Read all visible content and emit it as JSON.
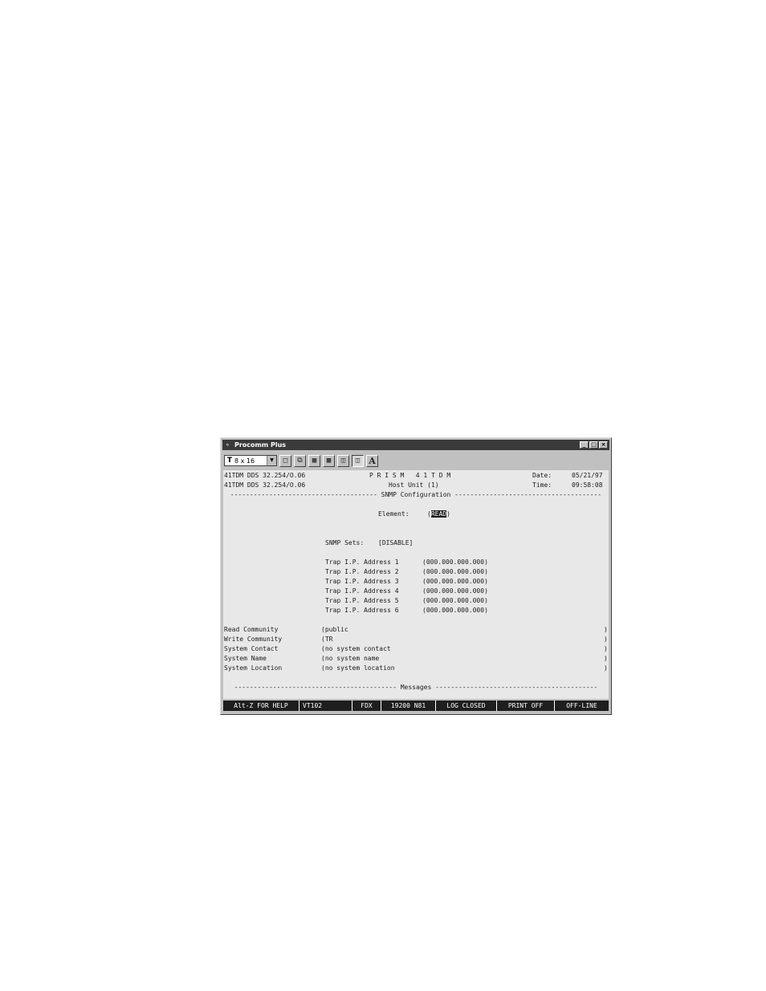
{
  "window": {
    "title": "Procomm Plus"
  },
  "toolbar": {
    "font_size_value": "8 x 16"
  },
  "terminal": {
    "header": {
      "line1_left": "41TDM DDS 32.254/O.06",
      "line1_center": "P R I S M   4 1 T D M",
      "line1_date_label": "Date:",
      "line1_date_value": "05/21/97",
      "line2_left": "41TDM DDS 32.254/O.06",
      "line2_center": "Host Unit (1)",
      "line2_time_label": "Time:",
      "line2_time_value": "09:58:08",
      "section_title": "SNMP Configuration"
    },
    "element_label": "Element:",
    "element_value": "READ",
    "snmp_sets_label": "SNMP Sets:",
    "snmp_sets_value": "[DISABLE]",
    "trap_addresses": [
      {
        "label": "Trap I.P. Address 1",
        "value": "(000.000.000.000)"
      },
      {
        "label": "Trap I.P. Address 2",
        "value": "(000.000.000.000)"
      },
      {
        "label": "Trap I.P. Address 3",
        "value": "(000.000.000.000)"
      },
      {
        "label": "Trap I.P. Address 4",
        "value": "(000.000.000.000)"
      },
      {
        "label": "Trap I.P. Address 5",
        "value": "(000.000.000.000)"
      },
      {
        "label": "Trap I.P. Address 6",
        "value": "(000.000.000.000)"
      }
    ],
    "fields": [
      {
        "label": "Read Community",
        "value": "(public"
      },
      {
        "label": "Write Community",
        "value": "(TR"
      },
      {
        "label": "System Contact",
        "value": "(no system contact"
      },
      {
        "label": "System Name",
        "value": "(no system name"
      },
      {
        "label": "System Location",
        "value": "(no system location"
      }
    ],
    "messages_title": "Messages"
  },
  "status_bar": {
    "help": "Alt-Z FOR HELP",
    "emulation": "VT102",
    "duplex": "FDX",
    "baud": "19200 N81",
    "log": "LOG CLOSED",
    "print": "PRINT OFF",
    "line": "OFF-LINE"
  }
}
